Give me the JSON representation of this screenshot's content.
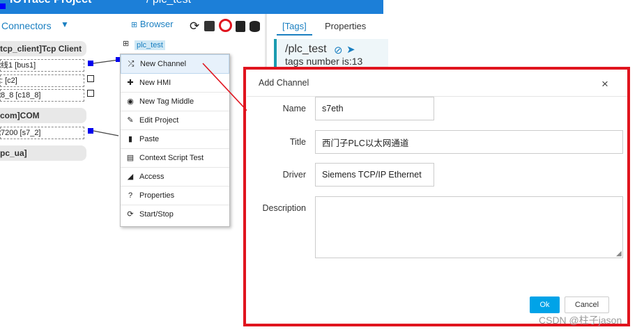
{
  "topbar": {
    "title": "IOTrace Project",
    "subtitle": "/ plc_test"
  },
  "connectors": {
    "label": "Connectors",
    "caret": "▼"
  },
  "left_groups": [
    {
      "head": "tcp_client]Tcp Client",
      "items": [
        "线1 [bus1]",
        ": [c2]",
        "8_8 [c18_8]"
      ]
    },
    {
      "head": "com]COM",
      "items": [
        "7200 [s7_2]"
      ]
    },
    {
      "head": "pc_ua]",
      "items": []
    }
  ],
  "browser": {
    "label": "Browser",
    "icons": [
      "refresh-icon",
      "share-icon",
      "power-icon",
      "book-icon",
      "database-icon"
    ]
  },
  "tree": {
    "node": "plc_test"
  },
  "context_menu": [
    {
      "label": "New Channel",
      "icon": "shuffle-icon",
      "glyph": "⤮"
    },
    {
      "label": "New HMI",
      "icon": "puzzle-icon",
      "glyph": "✚"
    },
    {
      "label": "New Tag Middle",
      "icon": "compass-icon",
      "glyph": "◉"
    },
    {
      "label": "Edit Project",
      "icon": "pencil-icon",
      "glyph": "✎"
    },
    {
      "label": "Paste",
      "icon": "clipboard-icon",
      "glyph": "▮"
    },
    {
      "label": "Context Script Test",
      "icon": "list-icon",
      "glyph": "▤"
    },
    {
      "label": "Access",
      "icon": "send-icon",
      "glyph": "◢"
    },
    {
      "label": "Properties",
      "icon": "question-icon",
      "glyph": "?"
    },
    {
      "label": "Start/Stop",
      "icon": "sync-icon",
      "glyph": "⟳"
    }
  ],
  "side_panel": {
    "tabs": [
      "[Tags]",
      "Properties"
    ],
    "title": "/plc_test",
    "tags_text": "tags number is:13"
  },
  "dialog": {
    "title": "Add Channel",
    "close": "×",
    "fields": {
      "name_label": "Name",
      "name_value": "s7eth",
      "title_label": "Title",
      "title_value": "西门子PLC以太网通道",
      "driver_label": "Driver",
      "driver_value": "Siemens TCP/IP Ethernet",
      "description_label": "Description",
      "description_value": ""
    },
    "ok_label": "Ok",
    "cancel_label": "Cancel"
  },
  "colors": {
    "accent": "#1a7fc1",
    "highlight_frame": "#e0141e",
    "ok_button": "#00a3e8",
    "topbar": "#1c7fd8"
  },
  "watermark": "CSDN @柱子jason"
}
